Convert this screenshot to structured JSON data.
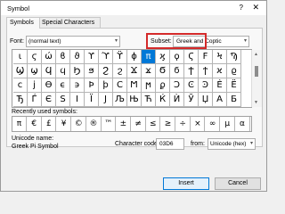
{
  "window": {
    "title": "Symbol",
    "help": "?",
    "close": "✕"
  },
  "tabs": [
    {
      "label": "Symbols",
      "active": true
    },
    {
      "label": "Special Characters",
      "active": false
    }
  ],
  "font": {
    "label": "Font:",
    "value": "(normal text)"
  },
  "subset": {
    "label": "Subset:",
    "value": "Greek and Coptic"
  },
  "grid": {
    "selected_symbol": "π",
    "symbols": [
      "ι",
      "ϛ",
      "ώ",
      "ϐ",
      "ϑ",
      "ϒ",
      "ϓ",
      "ϔ",
      "ϕ",
      "π",
      "ϗ",
      "ϙ",
      "Ϛ",
      "Ϝ",
      "Ϟ",
      "Ϡ",
      "Ϣ",
      "ϣ",
      "Ϥ",
      "ϥ",
      "Ϧ",
      "ϧ",
      "Ϩ",
      "ϩ",
      "Ϫ",
      "ϫ",
      "Ϭ",
      "ϭ",
      "Ϯ",
      "ϯ",
      "ϰ",
      "ϱ",
      "ϲ",
      "ϳ",
      "ϴ",
      "ϵ",
      "϶",
      "Ϸ",
      "ϸ",
      "Ϲ",
      "Ϻ",
      "ϻ",
      "ϼ",
      "Ͻ",
      "Ͼ",
      "Ͽ",
      "Ѐ",
      "Ё",
      "Ђ",
      "Ѓ",
      "Є",
      "Ѕ",
      "І",
      "Ї",
      "Ј",
      "Љ",
      "Њ",
      "Ћ",
      "Ќ",
      "Ѝ",
      "Ў",
      "Џ",
      "А",
      "Б"
    ]
  },
  "recent": {
    "label": "Recently used symbols:",
    "symbols": [
      "π",
      "€",
      "£",
      "¥",
      "©",
      "®",
      "™",
      "±",
      "≠",
      "≤",
      "≥",
      "÷",
      "×",
      "∞",
      "µ",
      "α"
    ]
  },
  "unicode_name": {
    "label": "Unicode name:",
    "value": "Greek Pi Symbol"
  },
  "character_code": {
    "label": "Character code:",
    "value": "03D6"
  },
  "from": {
    "label": "from:",
    "value": "Unicode (hex)"
  },
  "buttons": {
    "insert": "Insert",
    "cancel": "Cancel"
  },
  "colors": {
    "selection": "#0078d7",
    "highlight": "#d42a2a"
  }
}
